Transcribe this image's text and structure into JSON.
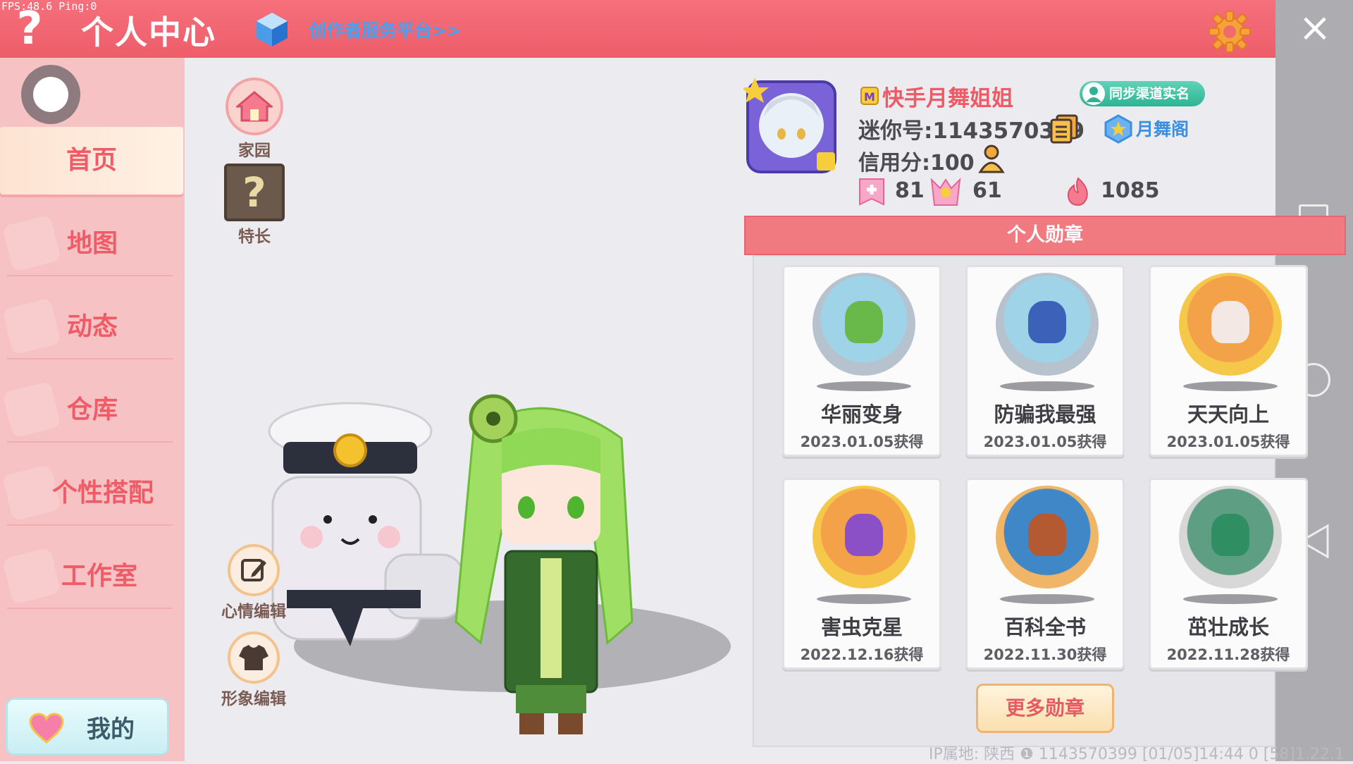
{
  "header": {
    "fps": "FPS:48.6  Ping:0",
    "title": "个人中心",
    "creator_link": "创作者服务平台>>",
    "help_icon": "question-icon",
    "settings_icon": "gear-icon",
    "accent": "#ef6270"
  },
  "sidebar": {
    "items": [
      {
        "label": "首页",
        "active": true
      },
      {
        "label": "地图"
      },
      {
        "label": "动态"
      },
      {
        "label": "仓库"
      },
      {
        "label": "个性搭配"
      },
      {
        "label": "工作室"
      }
    ],
    "mine_label": "我的"
  },
  "scene": {
    "home_label": "家园",
    "talent_label": "特长",
    "mood_label": "心情编辑",
    "appearance_label": "形象编辑"
  },
  "profile": {
    "nickname": "快手月舞姐姐",
    "sync_label": "同步渠道实名",
    "mini_id": "迷你号:1143570399",
    "guild": "月舞阁",
    "credit": "信用分:100",
    "stats": {
      "likes": "81",
      "fans": "61",
      "heat": "1085"
    }
  },
  "medals": {
    "header": "个人勋章",
    "items": [
      {
        "name": "华丽变身",
        "date": "2023.01.05获得",
        "style": "silver"
      },
      {
        "name": "防骗我最强",
        "date": "2023.01.05获得",
        "style": "silver"
      },
      {
        "name": "天天向上",
        "date": "2023.01.05获得",
        "style": "gold"
      },
      {
        "name": "害虫克星",
        "date": "2022.12.16获得",
        "style": "gold"
      },
      {
        "name": "百科全书",
        "date": "2022.11.30获得",
        "style": "bronze"
      },
      {
        "name": "茁壮成长",
        "date": "2022.11.28获得",
        "style": "stone"
      }
    ],
    "more_label": "更多勋章"
  },
  "footer": "IP属地: 陕西 ❶     1143570399    [01/05]14:44 0   [58]1.22.1"
}
